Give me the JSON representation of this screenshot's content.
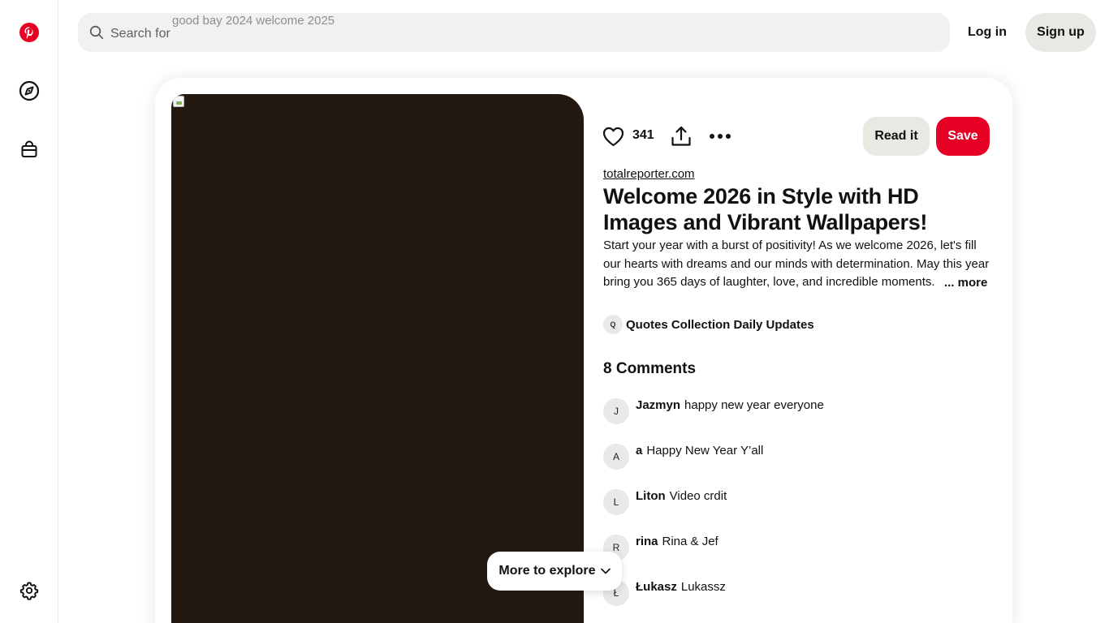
{
  "header": {
    "search_prefix": "Search for",
    "search_suggestion": "good bay 2024 welcome 2025",
    "login_label": "Log in",
    "signup_label": "Sign up"
  },
  "rail": {
    "icons": [
      "pinterest-logo-icon",
      "compass-explore-icon",
      "shop-bag-icon",
      "settings-gear-icon"
    ]
  },
  "pin": {
    "like_count": "341",
    "read_label": "Read it",
    "save_label": "Save",
    "source": "totalreporter.com",
    "title": "Welcome 2026 in Style with HD Images and Vibrant Wallpapers!",
    "description": "Start your year with a burst of positivity! As we welcome 2026, let's fill our hearts with dreams and our minds with determination. May this year bring you 365 days of laughter, love, and incredible moments.",
    "more_label": "... more",
    "board": {
      "avatar_letter": "Q",
      "name": "Quotes Collection Daily Updates"
    }
  },
  "comments": {
    "title": "8 Comments",
    "items": [
      {
        "initial": "J",
        "user": "Jazmyn",
        "text": "happy new year everyone"
      },
      {
        "initial": "A",
        "user": "a",
        "text": "Happy New Year Y’all"
      },
      {
        "initial": "L",
        "user": "Liton",
        "text": "Video crdit"
      },
      {
        "initial": "R",
        "user": "rina",
        "text": "Rina & Jef"
      },
      {
        "initial": "Ł",
        "user": "Łukasz",
        "text": "Lukassz"
      }
    ]
  },
  "explore": {
    "label": "More to explore"
  },
  "colors": {
    "brand_red": "#e60023",
    "media_bg": "#241912",
    "neutral_button": "#e9e9e3"
  }
}
